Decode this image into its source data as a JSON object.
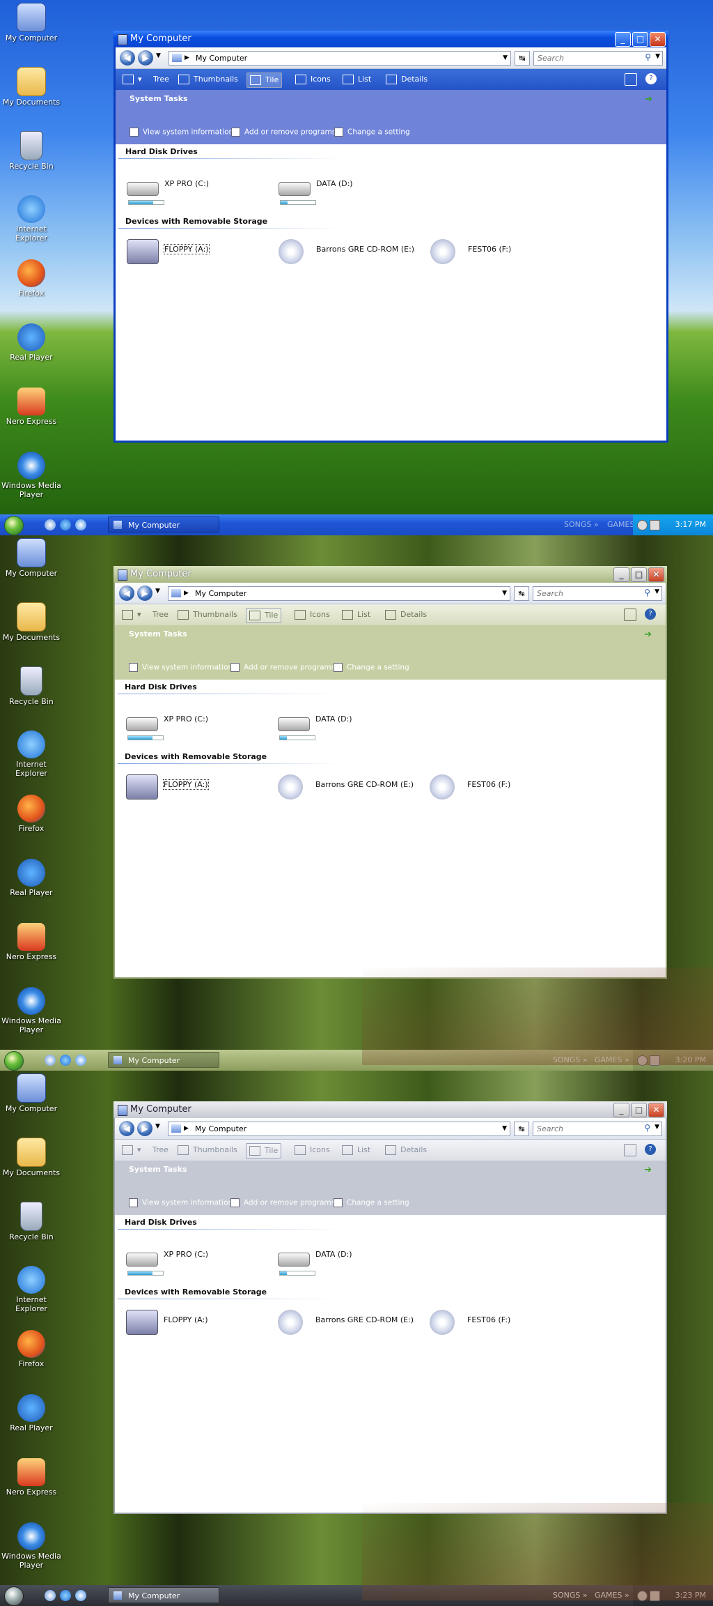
{
  "desktop_icons": [
    "My Computer",
    "My Documents",
    "Recycle Bin",
    "Internet Explorer",
    "Firefox",
    "Real Player",
    "Nero Express",
    "Windows Media Player"
  ],
  "window": {
    "title": "My Computer",
    "address": "My Computer",
    "search_placeholder": "Search",
    "toolbar": {
      "tree": "Tree",
      "thumbnails": "Thumbnails",
      "tile": "Tile",
      "icons": "Icons",
      "list": "List",
      "details": "Details"
    },
    "system_tasks": {
      "title": "System Tasks",
      "links": [
        "View system information",
        "Add or remove programs",
        "Change a setting"
      ]
    },
    "sections": {
      "hdd": "Hard Disk Drives",
      "removable": "Devices with Removable Storage"
    },
    "hard_drives": [
      {
        "label": "XP PRO (C:)",
        "used_fraction": 0.7
      },
      {
        "label": "DATA (D:)",
        "used_fraction": 0.2
      }
    ],
    "removable_drives": [
      {
        "label": "FLOPPY (A:)",
        "type": "floppy-icon"
      },
      {
        "label": "Barrons GRE CD-ROM (E:)",
        "type": "cd-drive-icon"
      },
      {
        "label": "FEST06 (F:)",
        "type": "cd-drive-icon"
      }
    ]
  },
  "taskbar": {
    "button": "My Computer",
    "toolbars": [
      "SONGS",
      "GAMES"
    ],
    "clocks": [
      "3:17 PM",
      "3:20 PM",
      "3:23 PM"
    ]
  },
  "colors": {
    "xp_blue": "#0a4ee0",
    "olive": "#a9b884",
    "silver": "#c6cad2",
    "accent_green": "#37a024"
  }
}
